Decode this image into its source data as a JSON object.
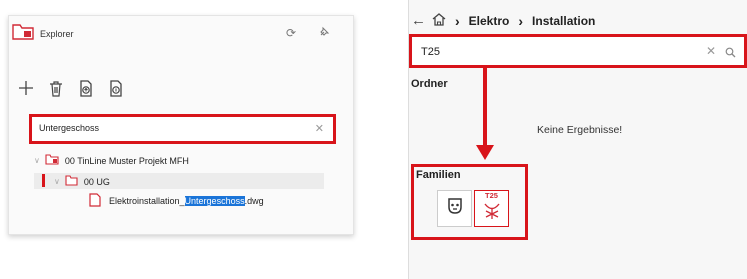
{
  "left_panel": {
    "title": "Explorer",
    "search": {
      "value": "Untergeschoss"
    },
    "tree": {
      "project": "00 TinLine Muster Projekt MFH",
      "folder": "00 UG",
      "file": {
        "prefix": "Elektroinstallation_",
        "highlight": "Untergeschoss",
        "suffix": ".dwg"
      }
    }
  },
  "right_panel": {
    "breadcrumb": [
      "Elektro",
      "Installation"
    ],
    "search": {
      "value": "T25"
    },
    "folders_label": "Ordner",
    "no_results": "Keine Ergebnisse!",
    "families_label": "Familien",
    "family_items": [
      {
        "icon": "socket-symbol-icon"
      },
      {
        "icon": "t25-lamp-symbol-icon",
        "badge": "T25"
      }
    ]
  },
  "colors": {
    "annotation_red": "#d8141a",
    "selection_blue": "#1a74d8",
    "icon_red": "#d12a36"
  }
}
